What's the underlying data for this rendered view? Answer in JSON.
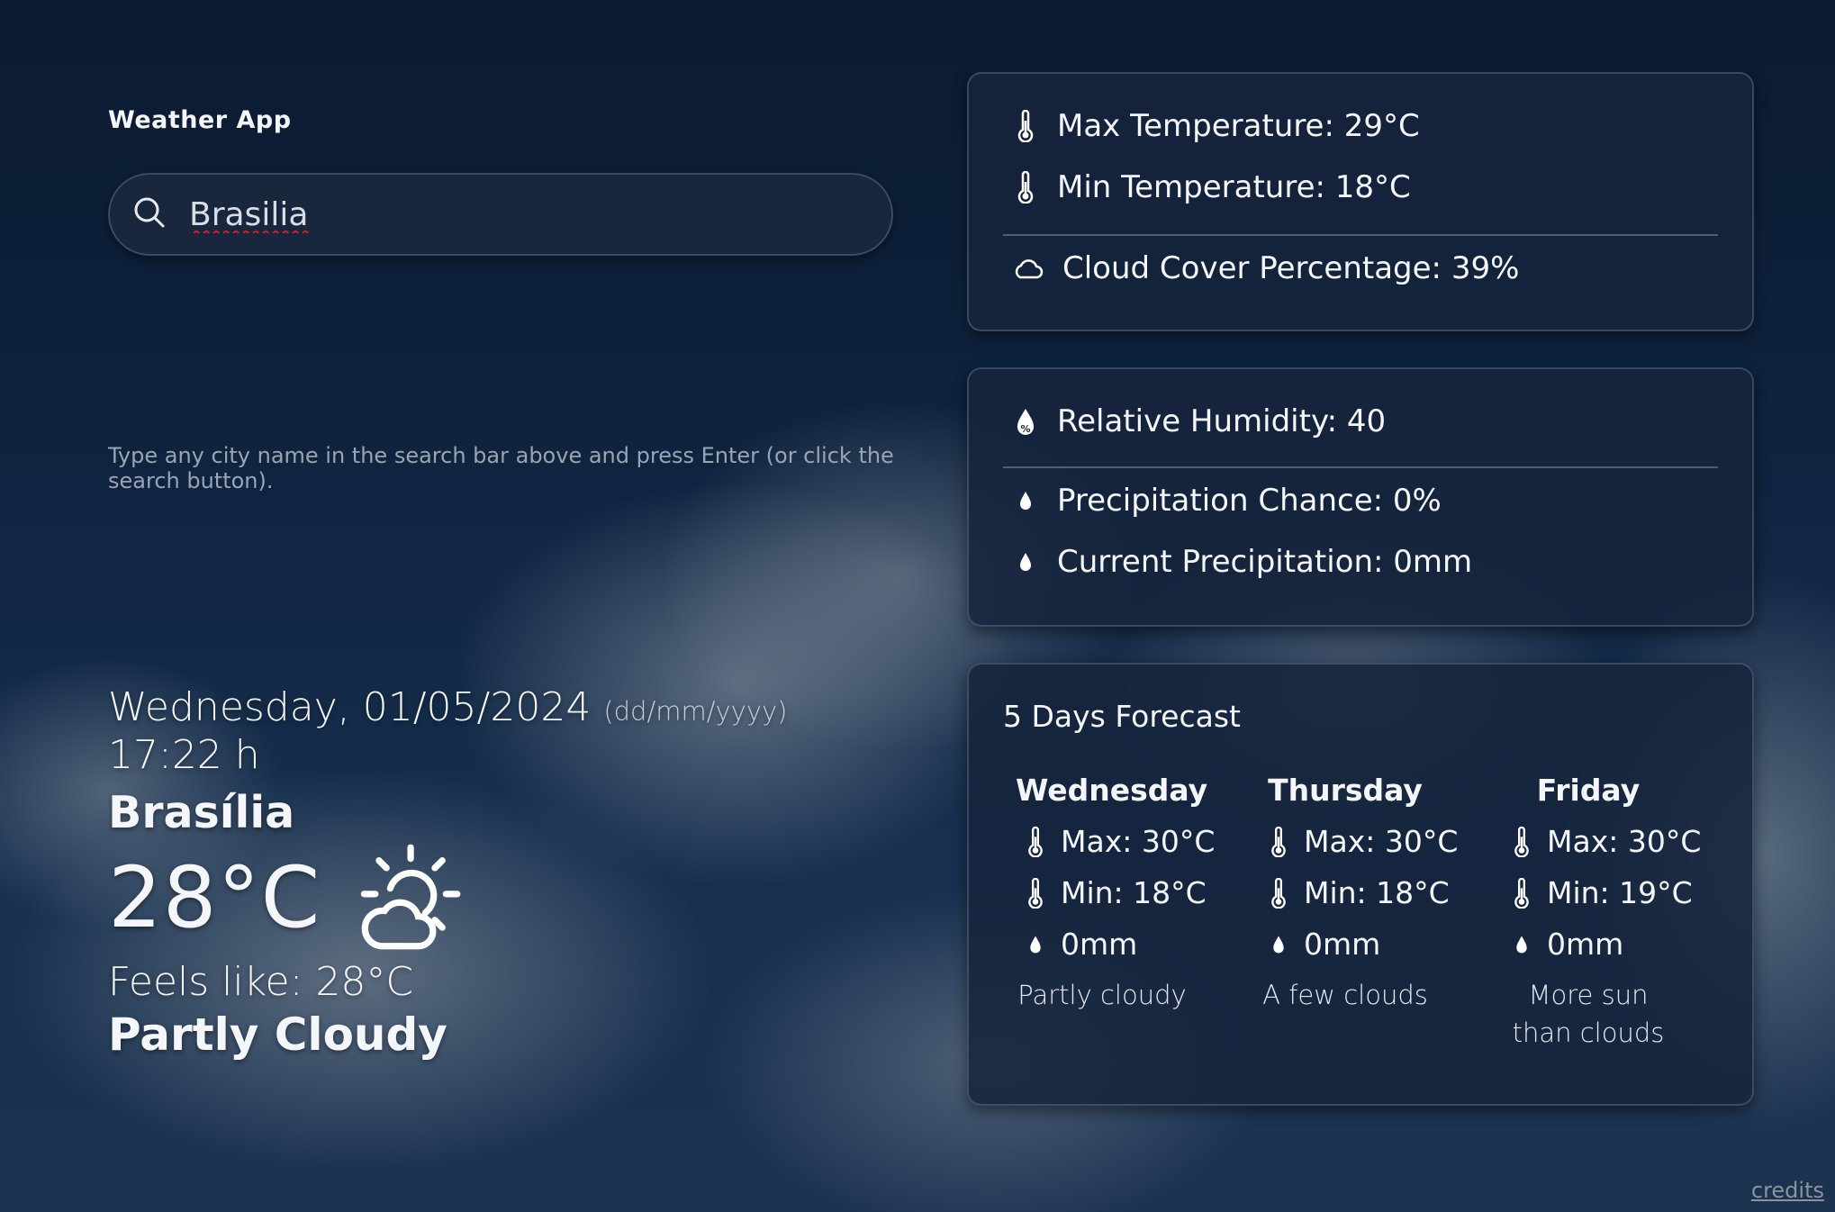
{
  "app_title": "Weather App",
  "search": {
    "value": "Brasilia",
    "icon": "search-icon"
  },
  "hint": "Type any city name in the search bar above and press Enter (or click the search button).",
  "current": {
    "date": "Wednesday, 01/05/2024",
    "date_format": "(dd/mm/yyyy)",
    "time": "17:22 h",
    "city": "Brasília",
    "temperature": "28°C",
    "weather_icon": "partly-cloudy-icon",
    "feels_like": "Feels like: 28°C",
    "description": "Partly Cloudy"
  },
  "stats_temp": {
    "max": "Max Temperature: 29°C",
    "min": "Min Temperature: 18°C",
    "cloud": "Cloud Cover Percentage: 39%"
  },
  "stats_precip": {
    "humidity": "Relative Humidity: 40",
    "chance": "Precipitation Chance: 0%",
    "current": "Current Precipitation: 0mm"
  },
  "forecast": {
    "title": "5 Days Forecast",
    "days": [
      {
        "name": "Wednesday",
        "max": "Max: 30°C",
        "min": "Min: 18°C",
        "precip": "0mm",
        "condition": "Partly cloudy"
      },
      {
        "name": "Thursday",
        "max": "Max: 30°C",
        "min": "Min: 18°C",
        "precip": "0mm",
        "condition": "A few clouds"
      },
      {
        "name": "Friday",
        "max": "Max: 30°C",
        "min": "Min: 19°C",
        "precip": "0mm",
        "condition": "More sun than clouds"
      }
    ]
  },
  "credits": "credits"
}
